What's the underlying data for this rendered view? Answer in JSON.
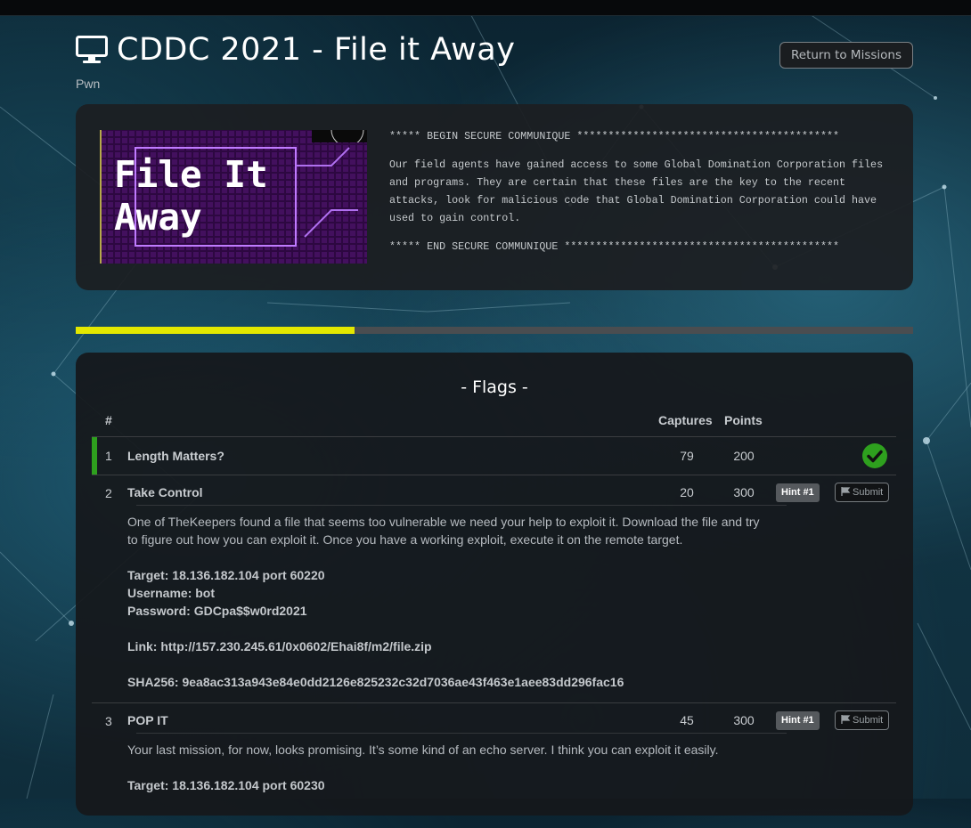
{
  "page": {
    "title": "CDDC 2021 - File it Away",
    "category": "Pwn",
    "return_label": "Return to Missions"
  },
  "briefing": {
    "art_title": "File It\nAway",
    "begin": "***** BEGIN SECURE COMMUNIQUE ******************************************",
    "body": "Our field agents have gained access to some Global Domination Corporation files and programs. They are certain that these files are the key to the recent attacks, look for malicious code that Global Domination Corporation could have used to gain control.",
    "end": "***** END SECURE COMMUNIQUE ********************************************"
  },
  "progress": {
    "fraction": 0.333,
    "fill_color": "#e3e800"
  },
  "flags": {
    "title": "- Flags -",
    "headers": {
      "num": "#",
      "captures": "Captures",
      "points": "Points"
    },
    "rows": [
      {
        "num": "1",
        "name": "Length Matters?",
        "captures": "79",
        "points": "200",
        "solved": true
      },
      {
        "num": "2",
        "name": "Take Control",
        "captures": "20",
        "points": "300",
        "solved": false,
        "hint_label": "Hint #1",
        "submit_label": "Submit",
        "description": "One of TheKeepers found a file that seems too vulnerable we need your help to exploit it. Download the file and try to figure out how you can exploit it. Once you have a working exploit, execute it on the remote target.",
        "target": "Target: 18.136.182.104 port 60220",
        "username": "Username: bot",
        "password": "Password: GDCpa$$w0rd2021",
        "link": "Link: http://157.230.245.61/0x0602/Ehai8f/m2/file.zip",
        "sha": "SHA256: 9ea8ac313a943e84e0dd2126e825232c32d7036ae43f463e1aee83dd296fac16"
      },
      {
        "num": "3",
        "name": "POP IT",
        "captures": "45",
        "points": "300",
        "solved": false,
        "hint_label": "Hint #1",
        "submit_label": "Submit",
        "description": "Your last mission, for now, looks promising. It’s some kind of an echo server. I think you can exploit it easily.",
        "target": "Target: 18.136.182.104 port 60230"
      }
    ]
  },
  "colors": {
    "solved": "#2ea01e",
    "accent": "#e3e800"
  },
  "icons": {
    "title": "monitor-icon",
    "solved": "check-circle-icon",
    "submit": "flag-icon"
  }
}
